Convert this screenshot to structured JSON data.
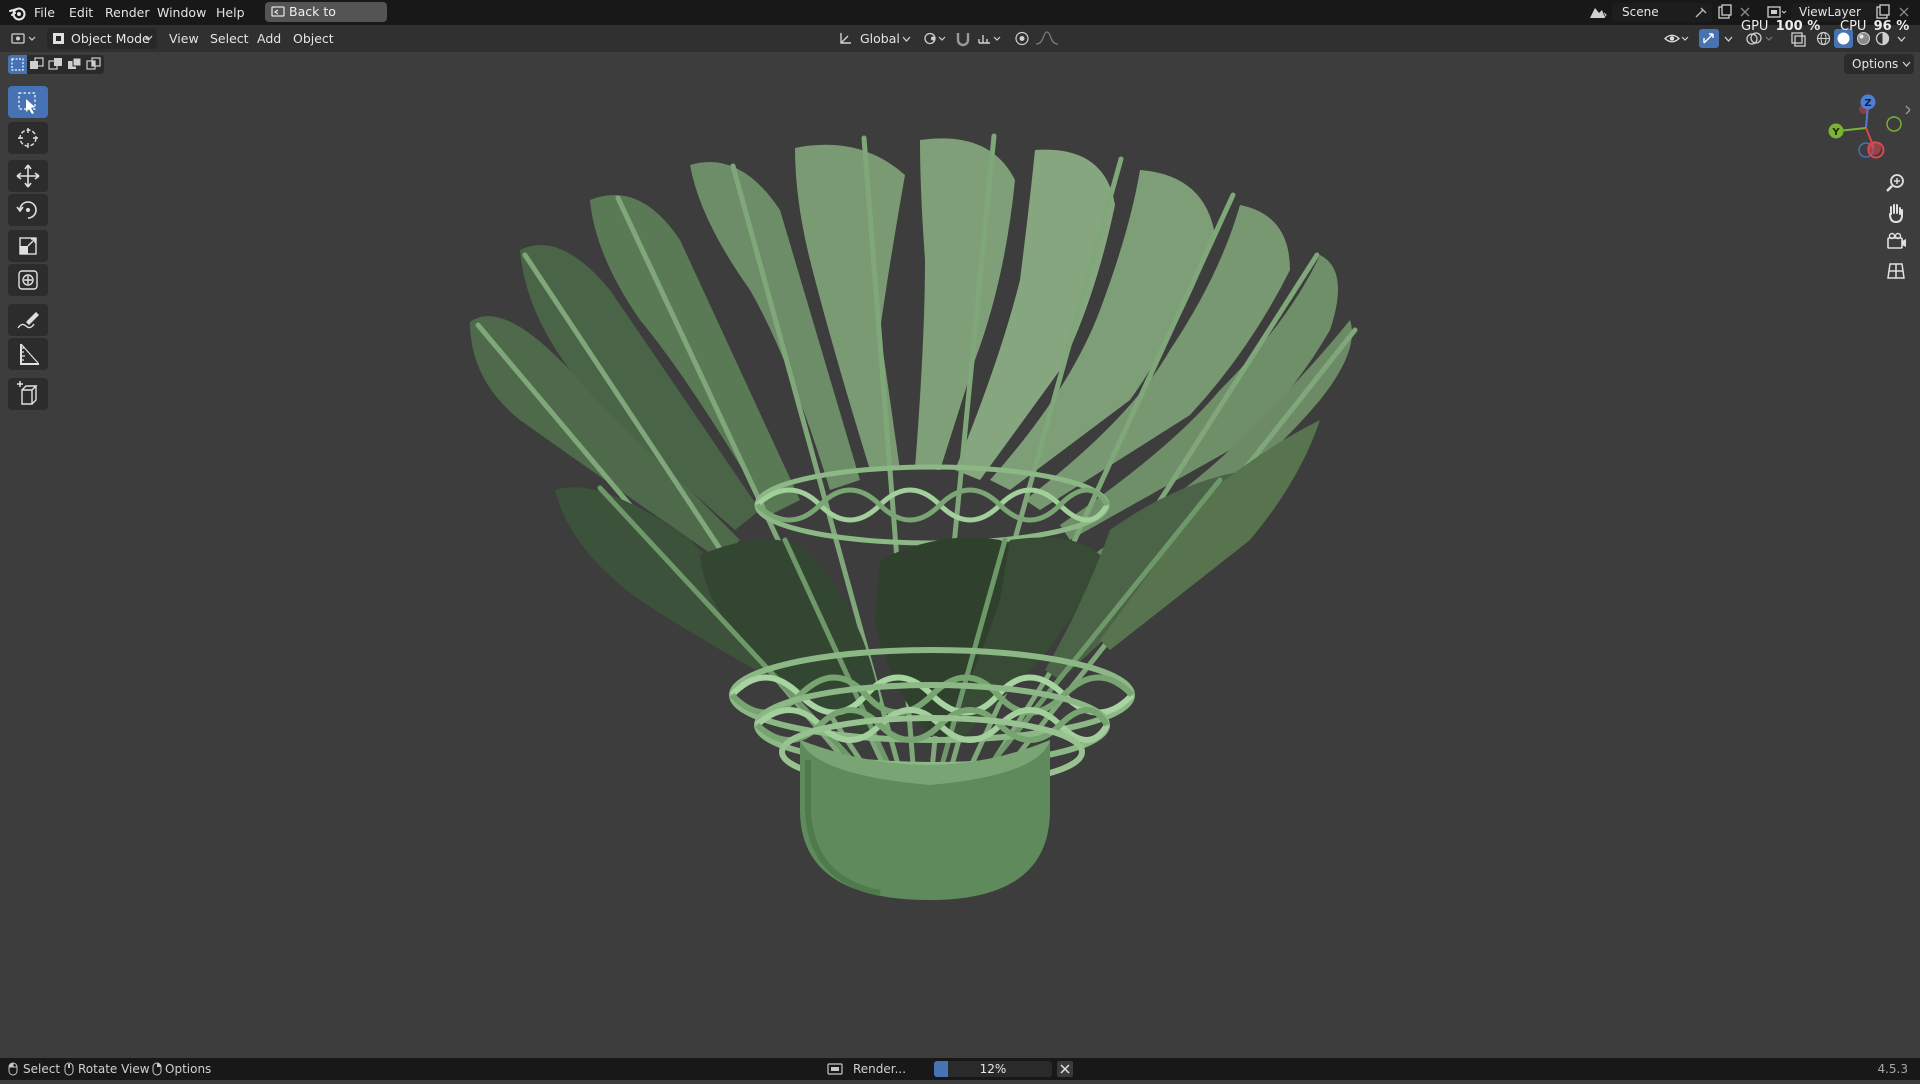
{
  "topbar": {
    "menu": [
      "File",
      "Edit",
      "Render",
      "Window",
      "Help"
    ],
    "back_label": "Back to Previous",
    "scene_label": "Scene",
    "view_layer_label": "ViewLayer",
    "gpu_label": "GPU",
    "gpu_value": "100 %",
    "cpu_label": "CPU",
    "cpu_value": "96 %"
  },
  "header": {
    "mode_label": "Object Mode",
    "menu": [
      "View",
      "Select",
      "Add",
      "Object"
    ],
    "orientation_label": "Global",
    "options_label": "Options"
  },
  "gizmo": {
    "z": "Z",
    "y": "Y"
  },
  "status": {
    "select_label": "Select",
    "rotate_label": "Rotate View",
    "options_label": "Options",
    "render_label": "Render...",
    "progress_text": "12%",
    "progress_value": 0.12,
    "version": "4.5.3"
  },
  "colors": {
    "accent": "#4772b3",
    "viewport_bg": "#3d3d3d",
    "model_green": "#6e9a6a"
  }
}
